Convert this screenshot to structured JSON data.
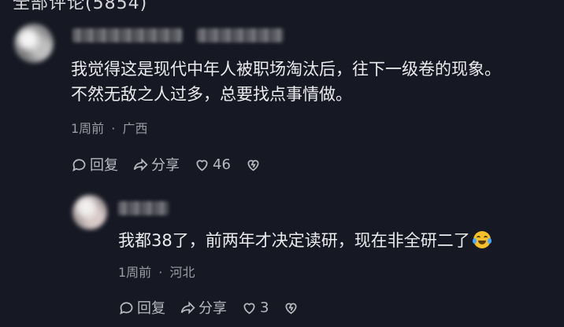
{
  "header": {
    "title": "全部评论(5854)"
  },
  "comments": [
    {
      "author": "",
      "lines": [
        "我觉得这是现代中年人被职场淘汰后，往下一级卷的现象。",
        "不然无敌之人过多，总要找点事情做。"
      ],
      "time": "1周前",
      "location": "广西",
      "separator": "·",
      "actions": {
        "reply": "回复",
        "share": "分享",
        "likes": "46"
      }
    },
    {
      "author": "",
      "lines": [
        "我都38了，前两年才决定读研，现在非全研二了"
      ],
      "emoji": "crying-laughing",
      "time": "1周前",
      "location": "河北",
      "separator": "·",
      "actions": {
        "reply": "回复",
        "share": "分享",
        "likes": "3"
      }
    }
  ],
  "colors": {
    "background": "#161823",
    "text": "#ececef",
    "meta": "#9b9ba3"
  }
}
